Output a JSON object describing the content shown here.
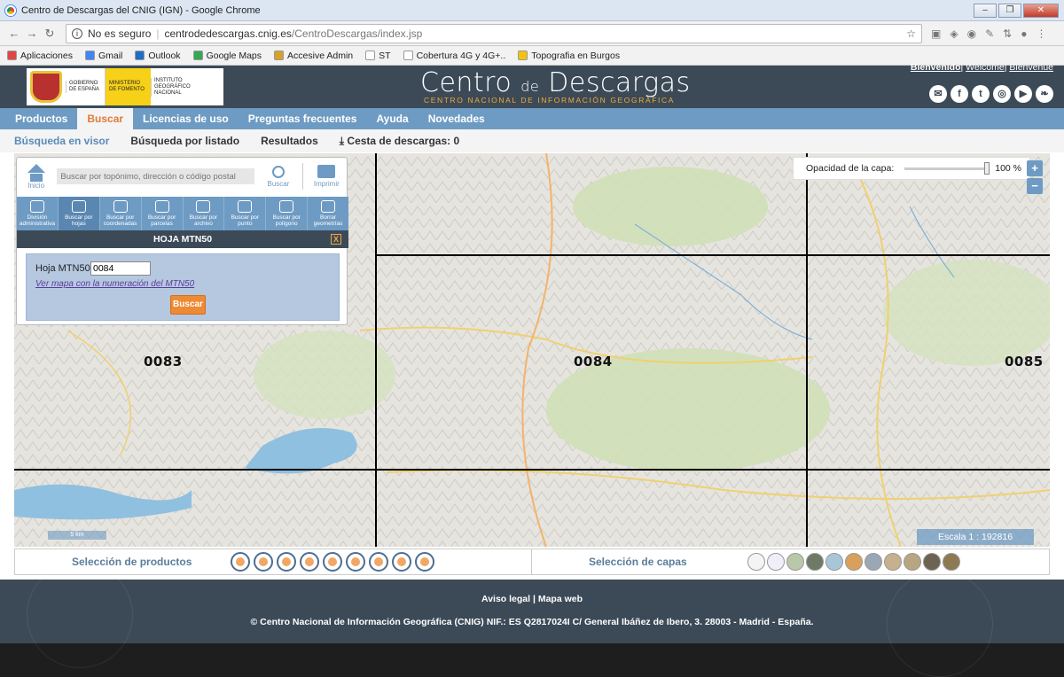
{
  "window": {
    "title": "Centro de Descargas del CNIG (IGN) - Google Chrome"
  },
  "browser": {
    "security": "No es seguro",
    "url_host": "centrodedescargas.cnig.es",
    "url_path": "/CentroDescargas/index.jsp",
    "bookmarks": [
      {
        "label": "Aplicaciones",
        "color": "#e04646"
      },
      {
        "label": "Gmail",
        "color": "#4285f4"
      },
      {
        "label": "Outlook",
        "color": "#1e6fc4"
      },
      {
        "label": "Google Maps",
        "color": "#34a853"
      },
      {
        "label": "Accesive Admin",
        "color": "#d6a22b"
      },
      {
        "label": "ST",
        "color": "#ffffff"
      },
      {
        "label": "Cobertura 4G y 4G+..",
        "color": "#ffffff"
      },
      {
        "label": "Topografia en Burgos",
        "color": "#f4c20d"
      }
    ]
  },
  "header": {
    "logo_gov": "GOBIERNO DE ESPAÑA",
    "logo_ministry": "MINISTERIO DE FOMENTO",
    "logo_ign": "INSTITUTO GEOGRÁFICO NACIONAL",
    "site_title_a": "Centro ",
    "site_title_de": "de",
    "site_title_b": " Descargas",
    "site_subtitle": "CENTRO NACIONAL DE INFORMACIÓN GEOGRÁFICA",
    "user_bienvenido": "Bienvenido",
    "user_welcome": "Welcome",
    "user_bienvenue": "Bienvenue",
    "social": [
      "✉",
      "f",
      "t",
      "◎",
      "▶",
      "❧"
    ]
  },
  "menu": [
    "Productos",
    "Buscar",
    "Licencias de uso",
    "Preguntas frecuentes",
    "Ayuda",
    "Novedades"
  ],
  "submenu": {
    "visor": "Búsqueda en visor",
    "listado": "Búsqueda por listado",
    "resultados": "Resultados",
    "cesta": "Cesta de descargas: 0"
  },
  "panel": {
    "inicio": "Inicio",
    "search_placeholder": "Buscar por topónimo, dirección o código postal",
    "buscar": "Buscar",
    "imprimir": "Imprimir",
    "tools": [
      "División administrativa",
      "Buscar por hojas",
      "Buscar por coordenadas",
      "Buscar por parcelas",
      "Buscar por archivo",
      "Buscar por punto",
      "Buscar por polígono",
      "Borrar geometrías"
    ],
    "hoja_title": "HOJA MTN50",
    "close": "X",
    "hoja_label": "Hoja MTN50:",
    "hoja_value": "0084",
    "hoja_link": "Ver mapa con la numeración del MTN50",
    "hoja_button": "Buscar"
  },
  "map": {
    "opacity_label": "Opacidad de la capa:",
    "opacity_value": "100 %",
    "zoom_in": "+",
    "zoom_out": "−",
    "scale_bar": "5 km",
    "scale_text": "Escala 1 : 192816",
    "sheets": [
      "0083",
      "0084",
      "0085"
    ]
  },
  "bottom": {
    "productos": "Selección de productos",
    "capas": "Selección de capas"
  },
  "footer": {
    "legal": "Aviso legal | Mapa web",
    "copyright": "© Centro Nacional de Información Geográfica (CNIG) NIF.: ES Q2817024I C/ General Ibáñez de Ibero, 3. 28003 - Madrid - España."
  }
}
